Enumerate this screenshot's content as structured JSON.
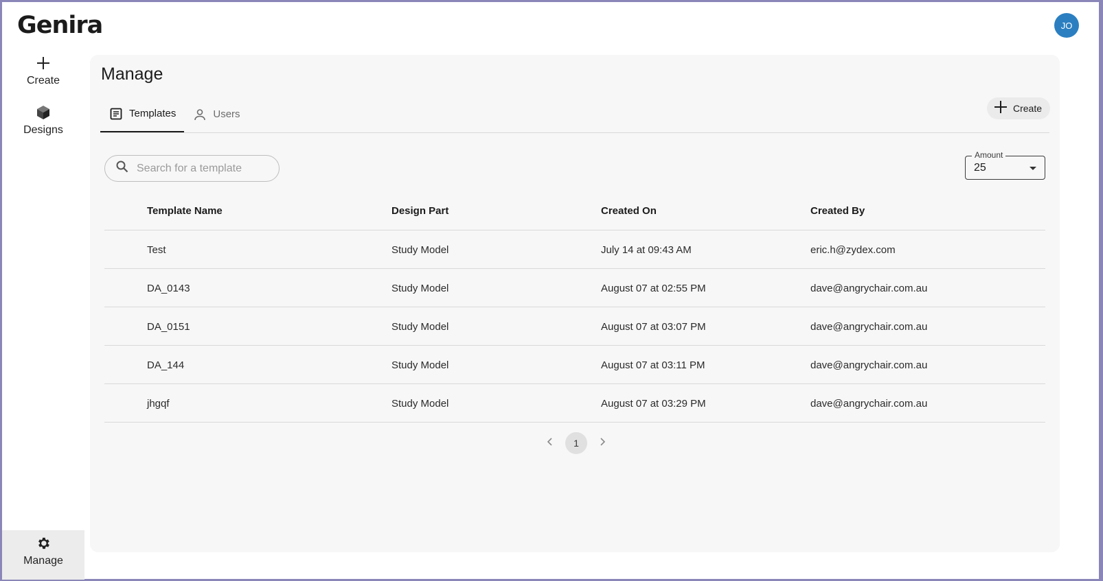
{
  "app": {
    "logo": "Genira",
    "avatar_initials": "JO",
    "accent_color": "#2b7fc1"
  },
  "nav": {
    "create_label": "Create",
    "designs_label": "Designs",
    "manage_label": "Manage"
  },
  "main": {
    "title": "Manage",
    "tabs": [
      {
        "label": "Templates",
        "active": true
      },
      {
        "label": "Users",
        "active": false
      }
    ],
    "create_button_label": "Create",
    "search": {
      "placeholder": "Search for a template",
      "value": ""
    },
    "amount": {
      "label": "Amount",
      "value": "25"
    }
  },
  "table": {
    "headers": [
      "Template Name",
      "Design Part",
      "Created On",
      "Created By"
    ],
    "rows": [
      [
        "Test",
        "Study Model",
        "July 14 at 09:43 AM",
        "eric.h@zydex.com"
      ],
      [
        "DA_0143",
        "Study Model",
        "August 07 at 02:55 PM",
        "dave@angrychair.com.au"
      ],
      [
        "DA_0151",
        "Study Model",
        "August 07 at 03:07 PM",
        "dave@angrychair.com.au"
      ],
      [
        "DA_144",
        "Study Model",
        "August 07 at 03:11 PM",
        "dave@angrychair.com.au"
      ],
      [
        "jhgqf",
        "Study Model",
        "August 07 at 03:29 PM",
        "dave@angrychair.com.au"
      ]
    ]
  },
  "pagination": {
    "current_page": "1",
    "prev_icon": "chevron-left-icon",
    "next_icon": "chevron-right-icon"
  }
}
